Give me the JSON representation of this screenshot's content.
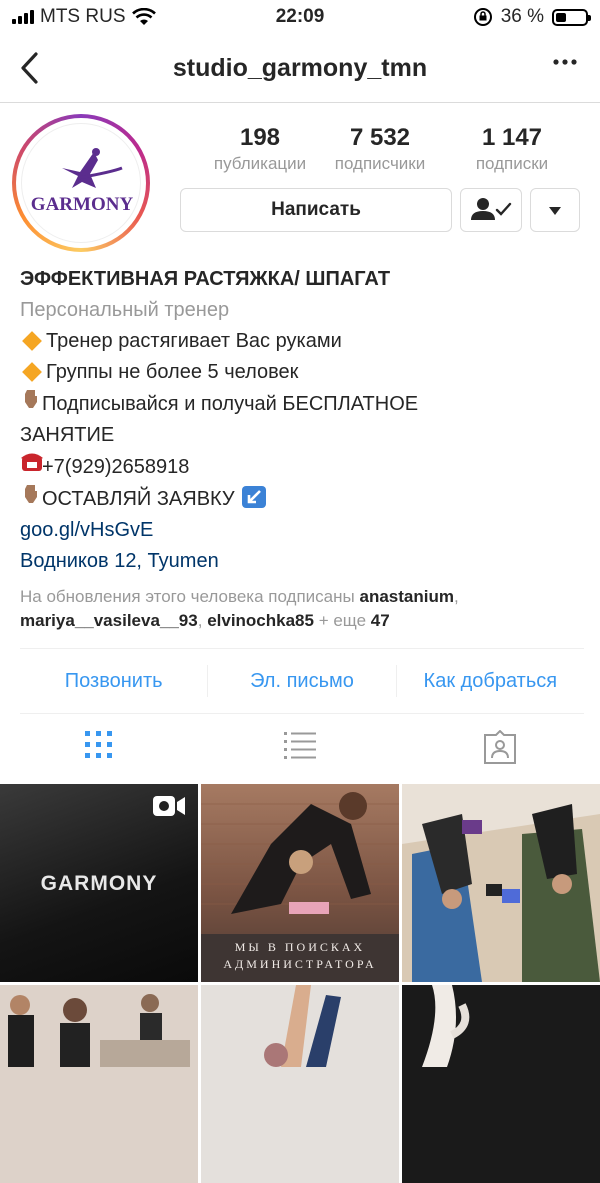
{
  "status_bar": {
    "carrier": "MTS RUS",
    "time": "22:09",
    "battery": "36 %",
    "battery_level": 0.36
  },
  "nav": {
    "title": "studio_garmony_tmn",
    "back_icon": "chevron-left-icon",
    "more_icon": "more-icon"
  },
  "profile": {
    "avatar_text": "GARMONY",
    "stats": [
      {
        "value": "198",
        "label": "публикации"
      },
      {
        "value": "7 532",
        "label": "подписчики"
      },
      {
        "value": "1 147",
        "label": "подписки"
      }
    ],
    "message_button": "Написать"
  },
  "bio": {
    "name": "ЭФФЕКТИВНАЯ РАСТЯЖКА/ ШПАГАТ",
    "category": "Персональный тренер",
    "line1": "Тренер растягивает Вас руками",
    "line2": "Группы не более 5 человек",
    "line3a": "Подписывайся и получай БЕСПЛАТНОЕ",
    "line3b": "ЗАНЯТИЕ",
    "phone": "+7(929)2658918",
    "line5": "ОСТАВЛЯЙ ЗАЯВКУ",
    "link": "goo.gl/vHsGvE",
    "address": "Водников 12, Tyumen",
    "followed_prefix": "На обновления этого человека подписаны",
    "followed_user1": "anastanium",
    "followed_user2": "mariya__vasileva__93",
    "followed_user3": "elvinochka85",
    "followed_more_prefix": "+ еще",
    "followed_more_count": "47"
  },
  "actions": {
    "call": "Позвонить",
    "email": "Эл. письмо",
    "directions": "Как добраться"
  },
  "grid": {
    "post1_text": "GARMONY",
    "post2_caption_line1": "МЫ В ПОИСКАХ",
    "post2_caption_line2": "АДМИНИСТРАТОРА"
  },
  "colors": {
    "link_blue": "#3897f0",
    "brand_purple": "#5b2d8e"
  }
}
